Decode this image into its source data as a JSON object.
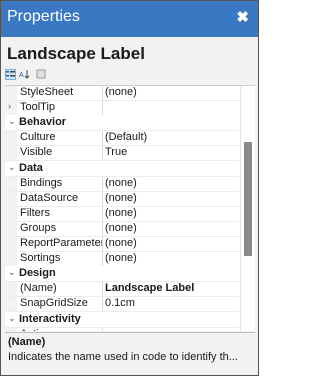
{
  "window": {
    "title": "Properties",
    "close_glyph": "✖"
  },
  "object_name": "Landscape Label",
  "toolbar": {
    "categorized_icon": "categorized-icon",
    "alphabetical_icon": "alphabetical-icon",
    "property_pages_icon": "property-pages-icon"
  },
  "grid": {
    "rows": [
      {
        "type": "prop",
        "name": "StyleSheet",
        "value": "(none)"
      },
      {
        "type": "prop",
        "name": "ToolTip",
        "value": "",
        "expander": "›"
      },
      {
        "type": "cat",
        "name": "Behavior",
        "expander": "⌄"
      },
      {
        "type": "prop",
        "name": "Culture",
        "value": "(Default)"
      },
      {
        "type": "prop",
        "name": "Visible",
        "value": "True"
      },
      {
        "type": "cat",
        "name": "Data",
        "expander": "⌄"
      },
      {
        "type": "prop",
        "name": "Bindings",
        "value": "(none)"
      },
      {
        "type": "prop",
        "name": "DataSource",
        "value": "(none)"
      },
      {
        "type": "prop",
        "name": "Filters",
        "value": "(none)"
      },
      {
        "type": "prop",
        "name": "Groups",
        "value": "(none)"
      },
      {
        "type": "prop",
        "name": "ReportParameters",
        "value": "(none)"
      },
      {
        "type": "prop",
        "name": "Sortings",
        "value": "(none)"
      },
      {
        "type": "cat",
        "name": "Design",
        "expander": "⌄"
      },
      {
        "type": "prop",
        "name": "(Name)",
        "value": "Landscape Label",
        "selected": true
      },
      {
        "type": "prop",
        "name": "SnapGridSize",
        "value": "0.1cm"
      },
      {
        "type": "cat",
        "name": "Interactivity",
        "expander": "⌄"
      },
      {
        "type": "prop",
        "name": "Action",
        "value": ""
      }
    ]
  },
  "description": {
    "name": "(Name)",
    "text": "Indicates the name used in code to identify th..."
  }
}
